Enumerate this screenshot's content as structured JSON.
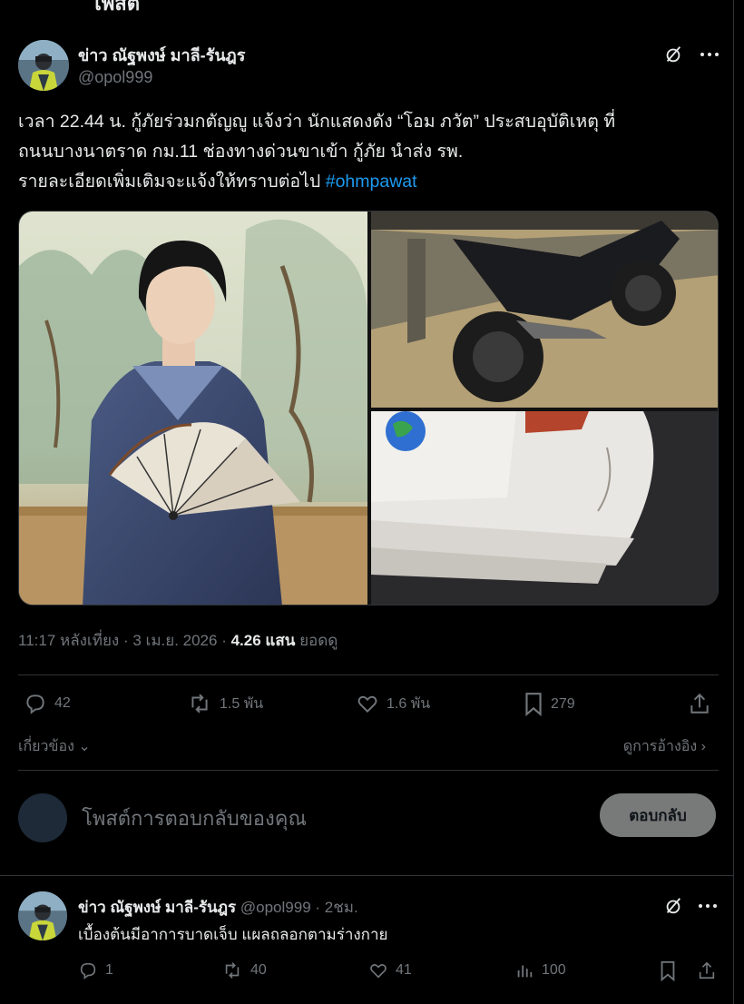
{
  "top_cut_text": "โพสต์",
  "post": {
    "author_name": "ข่าว ณัฐพงษ์ มาลี-รันฎร",
    "author_handle": "@opol999",
    "body_lines": [
      "เวลา 22.44 น. กู้ภัยร่วมกตัญญู แจ้งว่า นักแสดงดัง “โอม ภวัต” ประสบอุบัติเหตุ ที่",
      "ถนนบางนาตราด กม.11 ช่องทางด่วนขาเข้า กู้ภัย นำส่ง รพ.",
      "รายละเอียดเพิ่มเติมจะแจ้งให้ทราบต่อไป"
    ],
    "hashtag": "#ohmpawat",
    "time": "11:17 หลังเที่ยง",
    "date": "3 เม.ย. 2026",
    "views_value": "4.26 แสน",
    "views_label": "ยอดดู",
    "stats": {
      "replies": "42",
      "reposts": "1.5 พัน",
      "likes": "1.6 พัน",
      "bookmarks": "279"
    },
    "related_label": "เกี่ยวข้อง",
    "quotes_label": "ดูการอ้างอิง"
  },
  "compose": {
    "placeholder": "โพสต์การตอบกลับของคุณ",
    "reply_button": "ตอบกลับ"
  },
  "reply": {
    "author_name": "ข่าว ณัฐพงษ์ มาลี-รันฎร",
    "author_handle": "@opol999",
    "time_ago": "2ชม.",
    "text": "เบื้องต้นมีอาการบาดเจ็บ แผลถลอกตามร่างกาย",
    "stats": {
      "replies": "1",
      "reposts": "40",
      "likes": "41",
      "views": "100"
    }
  },
  "colors": {
    "background": "#000000",
    "text_primary": "#e7e9ea",
    "text_secondary": "#71767b",
    "link": "#1d9bf0",
    "divider": "#2f3336",
    "reply_button_bg": "#787a7a"
  },
  "icons": [
    "grok-icon",
    "more-icon",
    "reply-icon",
    "repost-icon",
    "like-icon",
    "bookmark-icon",
    "share-icon",
    "views-icon",
    "chevron-down-icon",
    "chevron-right-icon"
  ]
}
